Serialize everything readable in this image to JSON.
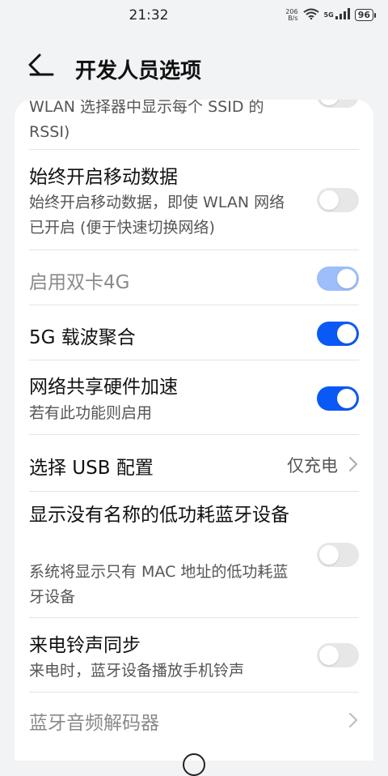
{
  "status_bar": {
    "time": "21:32",
    "net_speed_value": "206",
    "net_speed_unit": "B/s",
    "network_label": "5G",
    "battery": "96"
  },
  "header": {
    "title": "开发人员选项"
  },
  "settings": {
    "wlan_rssi": {
      "subtitle": "WLAN 选择器中显示每个 SSID 的 RSSI)"
    },
    "always_mobile_data": {
      "title": "始终开启移动数据",
      "subtitle": "始终开启移动数据，即使 WLAN 网络已开启 (便于快速切换网络)",
      "enabled": false
    },
    "dual_4g": {
      "title": "启用双卡4G",
      "enabled": true,
      "disabled": true
    },
    "carrier_aggregation": {
      "title": "5G 载波聚合",
      "enabled": true
    },
    "tethering_hw_accel": {
      "title": "网络共享硬件加速",
      "subtitle": "若有此功能则启用",
      "enabled": true
    },
    "usb_config": {
      "title": "选择 USB 配置",
      "value": "仅充电"
    },
    "ble_no_name": {
      "title": "显示没有名称的低功耗蓝牙设备",
      "subtitle": "系统将显示只有 MAC 地址的低功耗蓝牙设备",
      "enabled": false
    },
    "ringtone_sync": {
      "title": "来电铃声同步",
      "subtitle": "来电时，蓝牙设备播放手机铃声",
      "enabled": false
    },
    "bt_audio_codec": {
      "title": "蓝牙音频解码器"
    }
  },
  "colors": {
    "accent": "#0a59f7",
    "accent_disabled": "#9dbdfb",
    "toggle_off": "#e7e7e7",
    "background": "#f1f3f5"
  }
}
